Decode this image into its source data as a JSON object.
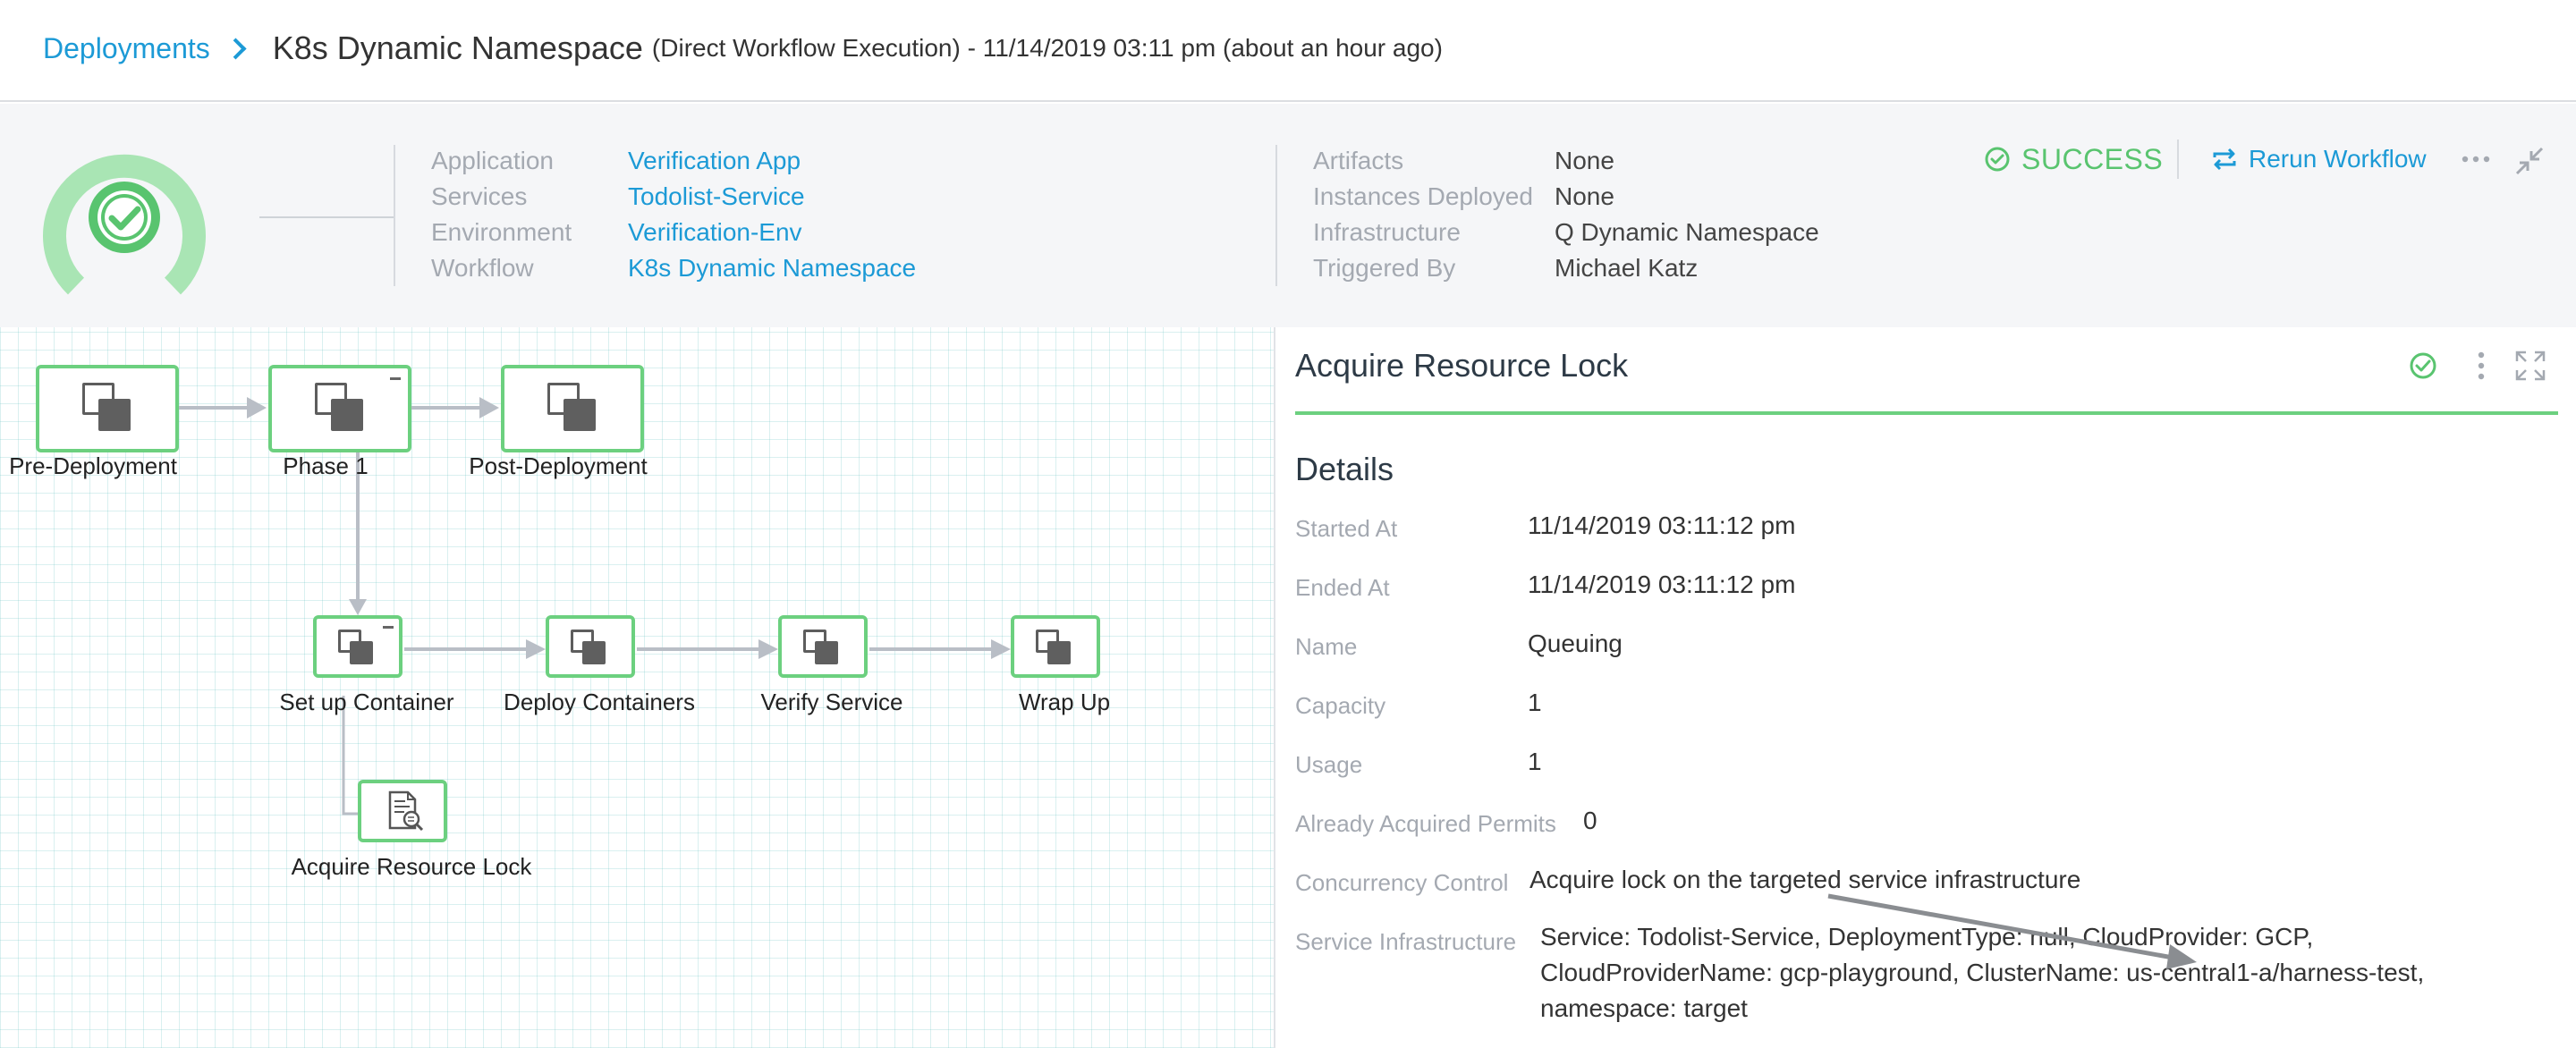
{
  "breadcrumb": {
    "parent": "Deployments",
    "title": "K8s Dynamic Namespace",
    "subtitle": "(Direct Workflow Execution) - 11/14/2019 03:11 pm (about an hour ago)"
  },
  "summary": {
    "left": [
      {
        "label": "Application",
        "value": "Verification App"
      },
      {
        "label": "Services",
        "value": "Todolist-Service"
      },
      {
        "label": "Environment",
        "value": "Verification-Env"
      },
      {
        "label": "Workflow",
        "value": "K8s Dynamic Namespace"
      }
    ],
    "right": [
      {
        "label": "Artifacts",
        "value": "None"
      },
      {
        "label": "Instances Deployed",
        "value": "None"
      },
      {
        "label": "Infrastructure",
        "value": "Q Dynamic Namespace"
      },
      {
        "label": "Triggered By",
        "value": "Michael Katz"
      }
    ],
    "status": "SUCCESS",
    "rerun_label": "Rerun Workflow",
    "status_color": "#59c46f",
    "link_color": "#1c9ad6"
  },
  "graph": {
    "nodes": [
      {
        "label": "Pre-Deployment",
        "icon": "phase-icon"
      },
      {
        "label": "Phase 1",
        "icon": "phase-icon"
      },
      {
        "label": "Post-Deployment",
        "icon": "phase-icon"
      },
      {
        "label": "Set up Container",
        "icon": "step-icon"
      },
      {
        "label": "Deploy Containers",
        "icon": "step-icon"
      },
      {
        "label": "Verify Service",
        "icon": "step-icon"
      },
      {
        "label": "Wrap Up",
        "icon": "step-icon"
      },
      {
        "label": "Acquire Resource Lock",
        "icon": "document-search-icon"
      }
    ]
  },
  "details": {
    "title": "Acquire Resource Lock",
    "section": "Details",
    "rows": [
      {
        "label": "Started At",
        "value": "11/14/2019 03:11:12 pm"
      },
      {
        "label": "Ended At",
        "value": "11/14/2019 03:11:12 pm"
      },
      {
        "label": "Name",
        "value": "Queuing"
      },
      {
        "label": "Capacity",
        "value": "1"
      },
      {
        "label": "Usage",
        "value": "1"
      },
      {
        "label": "Already Acquired Permits",
        "value": "0"
      },
      {
        "label": "Concurrency Control",
        "value": "Acquire lock on the targeted service infrastructure"
      },
      {
        "label": "Service Infrastructure",
        "value": "Service: Todolist-Service, DeploymentType: null, CloudProvider: GCP, CloudProviderName: gcp-playground, ClusterName: us-central1-a/harness-test, namespace: target"
      }
    ]
  }
}
